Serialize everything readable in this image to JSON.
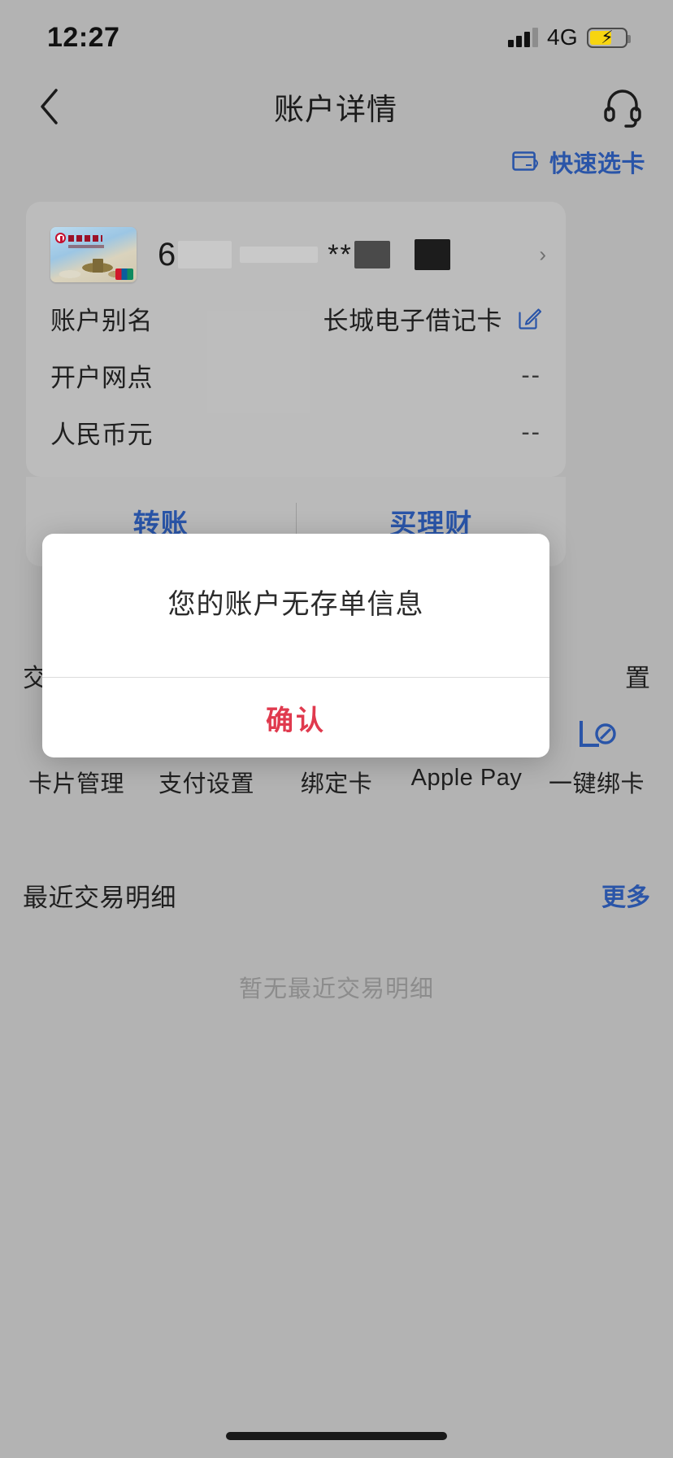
{
  "status_bar": {
    "time": "12:27",
    "network": "4G",
    "signal_icon": "signal-bars-icon",
    "battery_icon": "battery-charging-icon"
  },
  "nav": {
    "back_icon": "chevron-left-icon",
    "title": "账户详情",
    "support_icon": "headset-icon"
  },
  "quick_select": {
    "icon": "card-swipe-icon",
    "label": "快速选卡"
  },
  "card": {
    "thumbnail_icon": "bank-card-thumbnail-icon",
    "number_prefix": "6",
    "number_masked": "**",
    "expand_icon": "chevron-right-icon",
    "rows": [
      {
        "label": "账户别名",
        "value": "长城电子借记卡",
        "edit_icon": "edit-pencil-icon"
      },
      {
        "label": "开户网点",
        "value": "--"
      },
      {
        "label": "人民币元",
        "value": "--"
      }
    ]
  },
  "actions": [
    {
      "label": "转账"
    },
    {
      "label": "买理财"
    }
  ],
  "links_row": [
    {
      "label": "交"
    },
    {
      "label": "置"
    }
  ],
  "quick_actions": [
    {
      "label": "卡片管理",
      "icon": "card-management-icon",
      "color": "#2a55a8"
    },
    {
      "label": "支付设置",
      "icon": "payment-settings-icon",
      "color": "#2a55a8"
    },
    {
      "label": "绑定卡",
      "icon": "bind-card-icon",
      "color": "#d63640"
    },
    {
      "label": "Apple Pay",
      "icon": "apple-pay-icon",
      "color": "#3a3a3a"
    },
    {
      "label": "一键绑卡",
      "icon": "one-click-bind-icon",
      "color": "#2a55a8"
    }
  ],
  "recent": {
    "title": "最近交易明细",
    "more_label": "更多",
    "empty_text": "暂无最近交易明细"
  },
  "modal": {
    "message": "您的账户无存单信息",
    "confirm_label": "确认",
    "confirm_color": "#e03a4e"
  }
}
